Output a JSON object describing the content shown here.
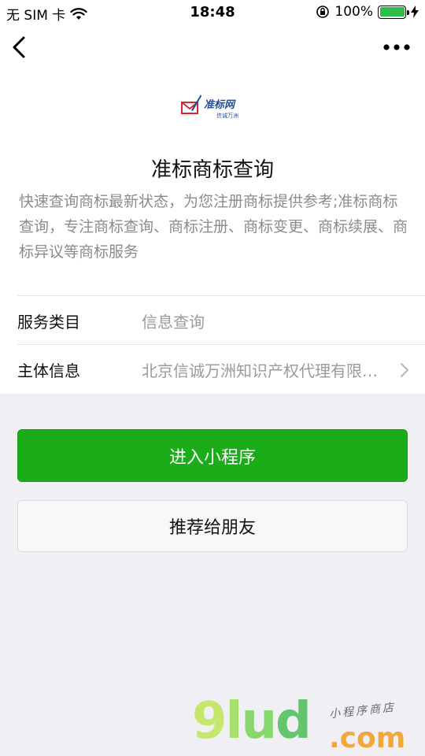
{
  "status_bar": {
    "carrier": "无 SIM 卡",
    "time": "18:48",
    "battery": "100%",
    "battery_level": 1.0
  },
  "navbar": {
    "back_icon": "chevron-left-icon",
    "more_icon": "more-dots-icon"
  },
  "logo": {
    "name": "准标网",
    "subtitle": "信诚万洲"
  },
  "app": {
    "title": "准标商标查询",
    "description": "快速查询商标最新状态，为您注册商标提供参考;准标商标查询，专注商标查询、商标注册、商标变更、商标续展、商标异议等商标服务"
  },
  "info": [
    {
      "label": "服务类目",
      "value": "信息查询"
    },
    {
      "label": "主体信息",
      "value": "北京信诚万洲知识产权代理有限公司"
    }
  ],
  "buttons": {
    "enter_label": "进入小程序",
    "share_label": "推荐给朋友"
  },
  "watermark": {
    "brand_9": "9",
    "brand_l": "l",
    "brand_u": "u",
    "brand_d": "d",
    "domain": ".com",
    "tagline": "小程序商店"
  },
  "colors": {
    "primary_green": "#1aad19",
    "battery_green": "#2dbd4b",
    "logo_blue": "#1e4f9c",
    "page_bg": "#efeff4"
  }
}
